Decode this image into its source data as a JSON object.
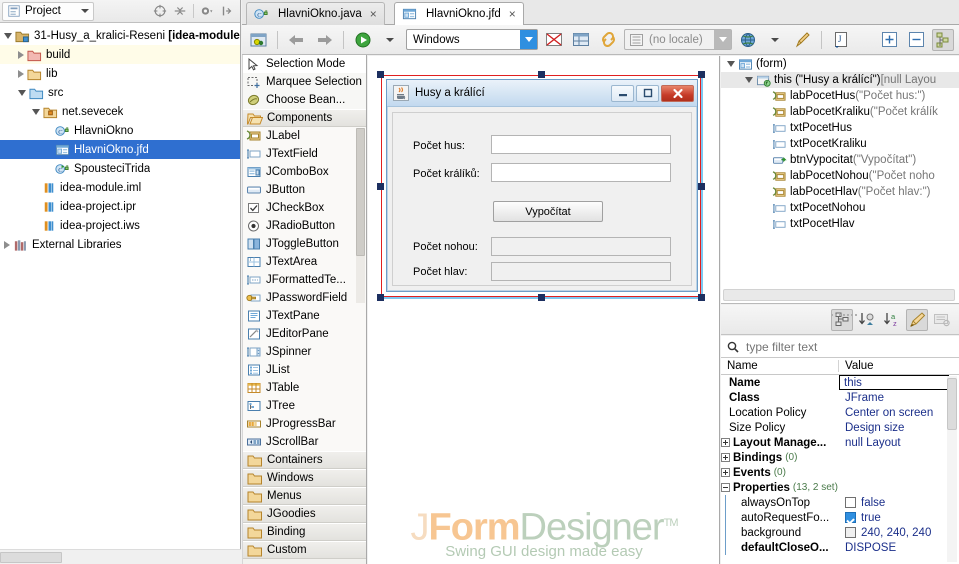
{
  "project_panel": {
    "title": "Project",
    "tools": [
      "target-icon",
      "collapse-icon",
      "gear-icon",
      "hide-icon"
    ],
    "tree": [
      {
        "label": "31-Husy_a_kralici-Reseni",
        "suffix": "[idea-module",
        "icon": "module-folder-icon",
        "depth": 0,
        "twisty": "down",
        "state": "normal"
      },
      {
        "label": "build",
        "suffix": "",
        "icon": "folder-red-icon",
        "depth": 1,
        "twisty": "right",
        "state": "highlight"
      },
      {
        "label": "lib",
        "suffix": "",
        "icon": "folder-orange-icon",
        "depth": 1,
        "twisty": "right",
        "state": "normal"
      },
      {
        "label": "src",
        "suffix": "",
        "icon": "folder-blue-icon",
        "depth": 1,
        "twisty": "down",
        "state": "normal"
      },
      {
        "label": "net.sevecek",
        "suffix": "",
        "icon": "package-icon",
        "depth": 2,
        "twisty": "down",
        "state": "normal"
      },
      {
        "label": "HlavniOkno",
        "suffix": "",
        "icon": "java-class-icon",
        "depth": 3,
        "twisty": "none",
        "state": "normal"
      },
      {
        "label": "HlavniOkno.jfd",
        "suffix": "",
        "icon": "jfd-file-icon",
        "depth": 3,
        "twisty": "none",
        "state": "selected"
      },
      {
        "label": "SpousteciTrida",
        "suffix": "",
        "icon": "java-runnable-class-icon",
        "depth": 3,
        "twisty": "none",
        "state": "normal"
      },
      {
        "label": "idea-module.iml",
        "suffix": "",
        "icon": "iml-file-icon",
        "depth": 2,
        "twisty": "none",
        "state": "normal"
      },
      {
        "label": "idea-project.ipr",
        "suffix": "",
        "icon": "iml-file-icon",
        "depth": 2,
        "twisty": "none",
        "state": "normal"
      },
      {
        "label": "idea-project.iws",
        "suffix": "",
        "icon": "iml-file-icon",
        "depth": 2,
        "twisty": "none",
        "state": "normal"
      },
      {
        "label": "External Libraries",
        "suffix": "",
        "icon": "libraries-icon",
        "depth": 0,
        "twisty": "right",
        "state": "normal"
      }
    ]
  },
  "tabs": [
    {
      "label": "HlavniOkno.java",
      "icon": "java-class-icon",
      "active": false,
      "close": "×"
    },
    {
      "label": "HlavniOkno.jfd",
      "icon": "jfd-file-icon",
      "active": true,
      "close": "×"
    }
  ],
  "design_toolbar": {
    "preview_icon": "preview-design-icon",
    "back_icon": "undo-arrow-icon",
    "forward_icon": "redo-arrow-icon",
    "run_icon": "run-green-icon",
    "run_dropdown_icon": "chevron-down-icon",
    "laf_value": "Windows",
    "mail_icon": "no-mail-icon",
    "table_icon": "table-icon",
    "link_icon": "chain-icon",
    "locale_value": "(no locale)",
    "globe_icon": "globe-icon",
    "globe_dropdown_icon": "chevron-down-icon",
    "pen_icon": "pen-icon",
    "jdoc_icon": "jdoc-icon",
    "expand_icon": "expand-all-icon",
    "collapse_icon": "collapse-all-icon",
    "structure_icon": "structure-toggle-icon"
  },
  "palette": {
    "modes": [
      {
        "label": "Selection Mode",
        "icon": "cursor-icon",
        "active": true
      },
      {
        "label": "Marquee Selection",
        "icon": "marquee-icon",
        "active": false
      },
      {
        "label": "Choose Bean...",
        "icon": "bean-icon",
        "active": false
      }
    ],
    "components_group": {
      "label": "Components",
      "icon": "open-folder-icon"
    },
    "components": [
      {
        "label": "JLabel",
        "icon": "jlabel-icon"
      },
      {
        "label": "JTextField",
        "icon": "jtextfield-icon"
      },
      {
        "label": "JComboBox",
        "icon": "jcombobox-icon"
      },
      {
        "label": "JButton",
        "icon": "jbutton-icon"
      },
      {
        "label": "JCheckBox",
        "icon": "jcheckbox-icon"
      },
      {
        "label": "JRadioButton",
        "icon": "jradiobutton-icon"
      },
      {
        "label": "JToggleButton",
        "icon": "jtogglebutton-icon"
      },
      {
        "label": "JTextArea",
        "icon": "jtextarea-icon"
      },
      {
        "label": "JFormattedTe...",
        "icon": "jformattedtextfield-icon"
      },
      {
        "label": "JPasswordField",
        "icon": "jpasswordfield-icon"
      },
      {
        "label": "JTextPane",
        "icon": "jtextpane-icon"
      },
      {
        "label": "JEditorPane",
        "icon": "jeditorpane-icon"
      },
      {
        "label": "JSpinner",
        "icon": "jspinner-icon"
      },
      {
        "label": "JList",
        "icon": "jlist-icon"
      },
      {
        "label": "JTable",
        "icon": "jtable-icon"
      },
      {
        "label": "JTree",
        "icon": "jtree-icon"
      },
      {
        "label": "JProgressBar",
        "icon": "jprogressbar-icon"
      },
      {
        "label": "JScrollBar",
        "icon": "jscrollbar-icon"
      }
    ],
    "groups": [
      {
        "label": "Containers",
        "icon": "folder-icon"
      },
      {
        "label": "Windows",
        "icon": "folder-icon"
      },
      {
        "label": "Menus",
        "icon": "folder-icon"
      },
      {
        "label": "JGoodies",
        "icon": "folder-icon"
      },
      {
        "label": "Binding",
        "icon": "folder-icon"
      },
      {
        "label": "Custom",
        "icon": "folder-icon"
      }
    ]
  },
  "design_form": {
    "window_title": "Husy a králící",
    "window_icon": "java-cup-icon",
    "buttons": {
      "minimize": "minimize-icon",
      "maximize": "maximize-icon",
      "close": "X"
    },
    "labels": [
      {
        "text": "Počet hus:"
      },
      {
        "text": "Počet králíků:"
      },
      {
        "text": "Počet nohou:"
      },
      {
        "text": "Počet hlav:"
      }
    ],
    "action_button": "Vypočítat"
  },
  "watermark": {
    "line1_a": "J",
    "line1_b": "Form",
    "line1_c": "Designer",
    "tm": "TM",
    "line2": "Swing GUI design made easy"
  },
  "structure": {
    "nodes": [
      {
        "label": "(form)",
        "extra": "",
        "depth": 0,
        "twisty": "down",
        "icon": "form-icon",
        "selected": false
      },
      {
        "label": "this (\"Husy a králící\")",
        "extra": "[null Layou",
        "depth": 1,
        "twisty": "down",
        "icon": "jframe-icon",
        "selected": true
      },
      {
        "label": "labPocetHus",
        "extra": "(\"Počet hus:\")",
        "depth": 2,
        "twisty": "none",
        "icon": "jlabel-icon",
        "selected": false
      },
      {
        "label": "labPocetKraliku",
        "extra": "(\"Počet králík",
        "depth": 2,
        "twisty": "none",
        "icon": "jlabel-icon",
        "selected": false
      },
      {
        "label": "txtPocetHus",
        "extra": "",
        "depth": 2,
        "twisty": "none",
        "icon": "jtextfield-icon",
        "selected": false
      },
      {
        "label": "txtPocetKraliku",
        "extra": "",
        "depth": 2,
        "twisty": "none",
        "icon": "jtextfield-icon",
        "selected": false
      },
      {
        "label": "btnVypocitat",
        "extra": "(\"Vypočítat\")",
        "depth": 2,
        "twisty": "none",
        "icon": "jbutton-event-icon",
        "selected": false
      },
      {
        "label": "labPocetNohou",
        "extra": "(\"Počet noho",
        "depth": 2,
        "twisty": "none",
        "icon": "jlabel-icon",
        "selected": false
      },
      {
        "label": "labPocetHlav",
        "extra": "(\"Počet hlav:\")",
        "depth": 2,
        "twisty": "none",
        "icon": "jlabel-icon",
        "selected": false
      },
      {
        "label": "txtPocetNohou",
        "extra": "",
        "depth": 2,
        "twisty": "none",
        "icon": "jtextfield-icon",
        "selected": false
      },
      {
        "label": "txtPocetHlav",
        "extra": "",
        "depth": 2,
        "twisty": "none",
        "icon": "jtextfield-icon",
        "selected": false
      }
    ]
  },
  "property_toolbar": {
    "buttons": [
      {
        "icon": "group-by-category-icon",
        "active": true
      },
      {
        "icon": "sort-by-definition-icon",
        "active": false
      },
      {
        "icon": "sort-alphabetically-icon",
        "active": false
      },
      {
        "icon": "restore-default-icon",
        "active": true
      },
      {
        "icon": "show-description-icon",
        "active": false,
        "disabled": true
      }
    ]
  },
  "filter": {
    "icon": "search-icon",
    "placeholder": "type filter text",
    "value": ""
  },
  "properties": {
    "header": {
      "name": "Name",
      "value": "Value"
    },
    "rows": [
      {
        "name": "Name",
        "value": "this",
        "bold": true,
        "expander": "none",
        "editing": true
      },
      {
        "name": "Class",
        "value": "JFrame",
        "bold": true,
        "expander": "none"
      },
      {
        "name": "Location Policy",
        "value": "Center on screen",
        "bold": false,
        "expander": "none"
      },
      {
        "name": "Size Policy",
        "value": "Design size",
        "bold": false,
        "expander": "none"
      },
      {
        "name": "Layout Manage...",
        "value": "null Layout",
        "bold": true,
        "expander": "plus"
      },
      {
        "name": "Bindings",
        "count": "(0)",
        "value": "",
        "bold": true,
        "expander": "plus"
      },
      {
        "name": "Events",
        "count": "(0)",
        "value": "",
        "bold": true,
        "expander": "plus"
      },
      {
        "name": "Properties",
        "count": "(13, 2 set)",
        "value": "",
        "bold": true,
        "expander": "minus"
      },
      {
        "name": "alwaysOnTop",
        "value": "false",
        "bold": false,
        "expander": "none",
        "indent": true,
        "checkbox": "off"
      },
      {
        "name": "autoRequestFo...",
        "value": "true",
        "bold": false,
        "expander": "none",
        "indent": true,
        "checkbox": "on"
      },
      {
        "name": "background",
        "value": "240, 240, 240",
        "bold": false,
        "expander": "none",
        "indent": true,
        "swatch": "#f0f0f0"
      },
      {
        "name": "defaultCloseO...",
        "value": "DISPOSE",
        "bold": true,
        "expander": "none",
        "indent": true
      }
    ]
  },
  "colors": {
    "selection_blue": "#2f6fd0",
    "accent_blue": "#2f8fe0",
    "selection_red": "#e02020",
    "handle_navy": "#1c2f60",
    "property_value": "#1b2f8a",
    "background_gray": "#f0f0f0"
  }
}
